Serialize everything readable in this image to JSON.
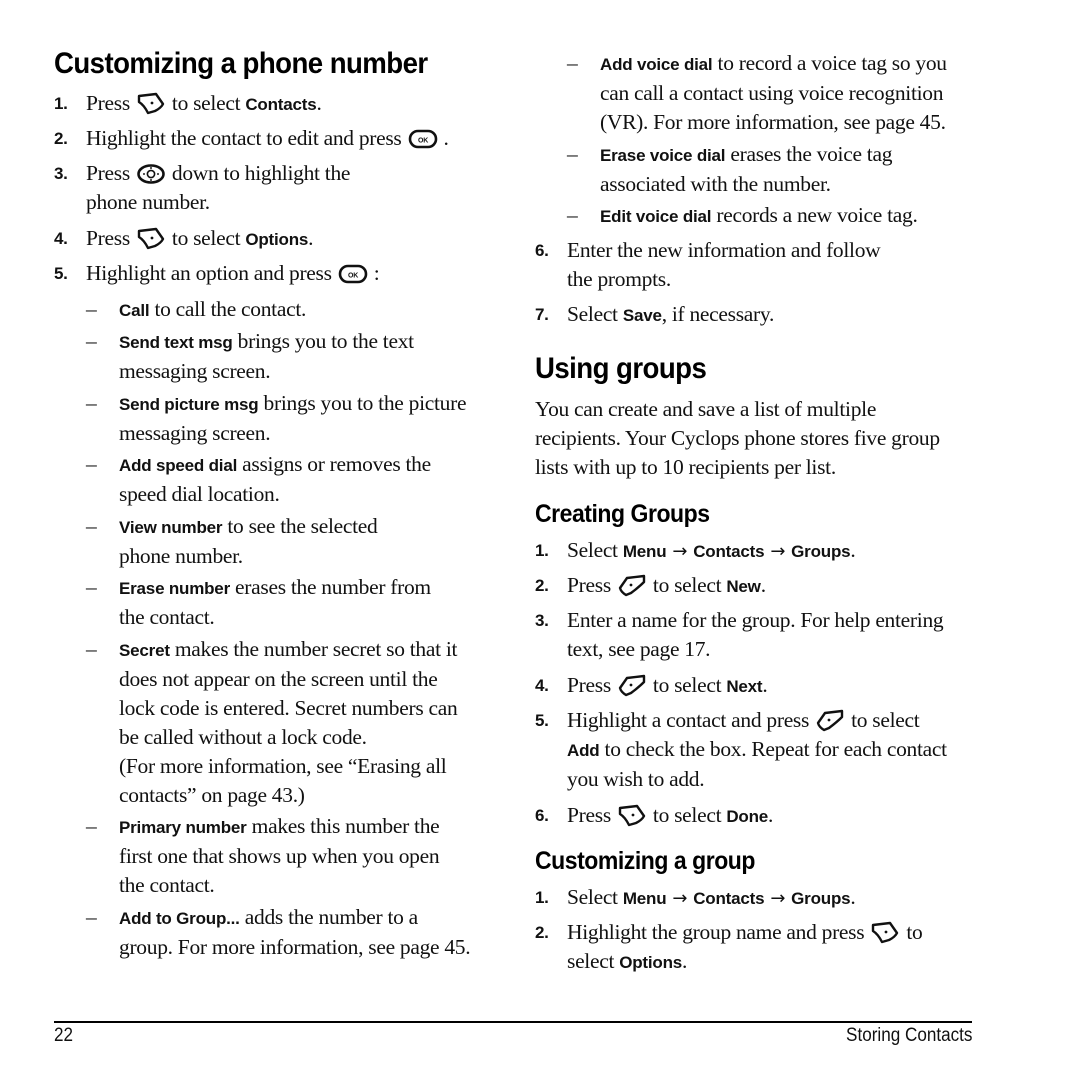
{
  "left": {
    "title": "Customizing a phone number",
    "steps": [
      {
        "num": "1.",
        "pre": "Press",
        "icon": "left-softkey-icon",
        "post": "to select",
        "bold": "Contacts",
        "end": "."
      },
      {
        "num": "2.",
        "pre": "Highlight the contact to edit and press",
        "icon": "ok-key-icon",
        "end": "."
      },
      {
        "num": "3.",
        "pre": "Press",
        "icon": "navigation-key-icon",
        "post": "down to highlight the",
        "line2": "phone number."
      },
      {
        "num": "4.",
        "pre": "Press",
        "icon": "left-softkey-icon",
        "post": "to select",
        "bold": "Options",
        "end": "."
      },
      {
        "num": "5.",
        "pre": "Highlight an option and press",
        "icon": "ok-key-icon",
        "end": ":"
      }
    ],
    "options": [
      {
        "mark": "–",
        "bold": "Call",
        "text": " to call the contact."
      },
      {
        "mark": "–",
        "bold": "Send text msg",
        "text": " brings you to the text",
        "line2": "messaging screen."
      },
      {
        "mark": "–",
        "bold": "Send picture msg",
        "text": " brings you to the picture",
        "line2": "messaging screen."
      },
      {
        "mark": "–",
        "bold": "Add speed dial",
        "text": " assigns or removes the",
        "line2": "speed dial location."
      },
      {
        "mark": "–",
        "bold": "View number",
        "text": " to see the selected",
        "line2": "phone number."
      },
      {
        "mark": "–",
        "bold": "Erase number",
        "text": " erases the number from",
        "line2": "the contact."
      },
      {
        "mark": "–",
        "bold": "Secret",
        "text": " makes the number secret so that it",
        "line2": "does not appear on the screen until the",
        "line3": "lock code is entered. Secret numbers can",
        "line4": "be called without a lock code.",
        "note1": "(For more information, see “Erasing all",
        "note2": "contacts” on page 43.)"
      },
      {
        "mark": "–",
        "bold": "Primary number",
        "text": " makes this number the",
        "line2": "first one that shows up when you open",
        "line3": "the contact."
      },
      {
        "mark": "–",
        "bold": "Add to Group...",
        "text": " adds the number to a",
        "line2": "group. For more information, see page 45."
      }
    ]
  },
  "right": {
    "options": [
      {
        "mark": "–",
        "bold": "Add voice dial",
        "text": " to record a voice tag so you",
        "line2": "can call a contact using voice recognition",
        "line3": "(VR). For more information, see page 45."
      },
      {
        "mark": "–",
        "bold": "Erase voice dial",
        "text": " erases the voice tag",
        "line2": "associated with the number."
      },
      {
        "mark": "–",
        "bold": "Edit voice dial",
        "text": " records a new voice tag."
      }
    ],
    "steps": [
      {
        "num": "6.",
        "text": "Enter the new information and follow",
        "line2": "the prompts."
      },
      {
        "num": "7.",
        "pre": "Select",
        "bold": "Save",
        "end": ", if necessary."
      }
    ],
    "using_groups": {
      "title": "Using groups",
      "para": [
        "You can create and save a list of multiple",
        "recipients. Your Cyclops phone stores five group",
        "lists with up to 10 recipients per list."
      ]
    },
    "creating_groups": {
      "title": "Creating Groups",
      "steps": [
        {
          "num": "1.",
          "pre": "Select",
          "path": [
            "Menu",
            "Contacts",
            "Groups"
          ],
          "arrow": "→",
          "end": "."
        },
        {
          "num": "2.",
          "pre": "Press",
          "icon": "right-softkey-icon",
          "post": "to select",
          "bold": "New",
          "end": "."
        },
        {
          "num": "3.",
          "text": "Enter a name for the group. For help entering",
          "line2": "text, see page 17."
        },
        {
          "num": "4.",
          "pre": "Press",
          "icon": "right-softkey-icon",
          "post": "to select",
          "bold": "Next",
          "end": "."
        },
        {
          "num": "5.",
          "pre": "Highlight a contact and press",
          "icon": "right-softkey-icon",
          "post": "to select",
          "bold2": "Add",
          "line2": " to check the box. Repeat for each contact",
          "line3": "you wish to add."
        },
        {
          "num": "6.",
          "pre": "Press",
          "icon": "left-softkey-icon",
          "post": "to select",
          "bold": "Done",
          "end": "."
        }
      ]
    },
    "customizing_group": {
      "title": "Customizing a group",
      "steps": [
        {
          "num": "1.",
          "pre": "Select",
          "path": [
            "Menu",
            "Contacts",
            "Groups"
          ],
          "arrow": "→",
          "end": "."
        },
        {
          "num": "2.",
          "pre": "Highlight the group name and press",
          "icon": "left-softkey-icon",
          "post": "to",
          "line2pre": "select ",
          "bold": "Options",
          "end": "."
        }
      ]
    }
  },
  "footer": {
    "page_number": "22",
    "chapter": "Storing Contacts"
  }
}
